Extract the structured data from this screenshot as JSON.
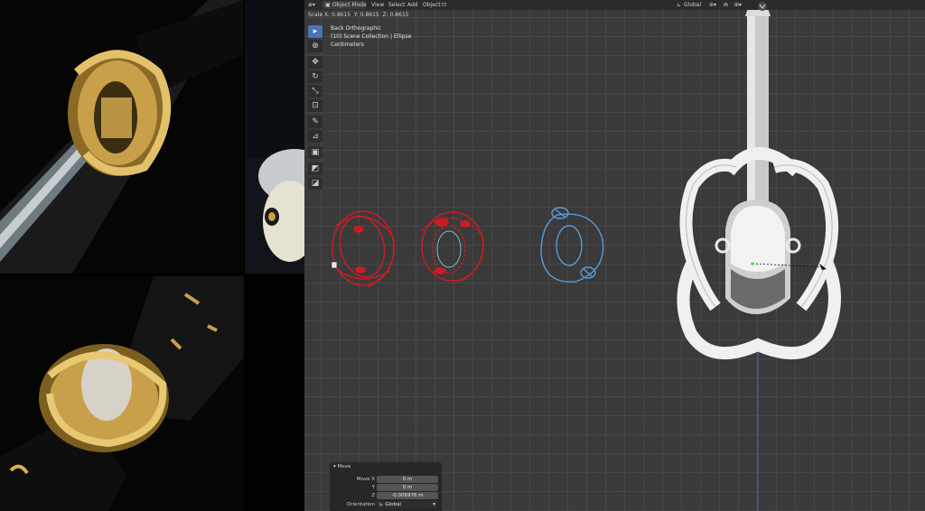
{
  "header": {
    "mode_label": "Object Mode",
    "menu": [
      "View",
      "Select",
      "Add",
      "Object"
    ],
    "transform_orientation": "Global"
  },
  "scale_readout": {
    "x": "Scale X: 0.8615",
    "y": "Y: 0.8615",
    "z": "Z: 0.8615"
  },
  "view_info": {
    "view_name": "Back Orthographic",
    "collection": "(10) Scene Collection | Ellipse",
    "units": "Centimeters"
  },
  "toolbar": {
    "tools": [
      {
        "name": "select-box-tool",
        "glyph": "▸"
      },
      {
        "name": "cursor-tool",
        "glyph": "⊕"
      },
      {
        "name": "move-tool",
        "glyph": "✥"
      },
      {
        "name": "rotate-tool",
        "glyph": "↻"
      },
      {
        "name": "scale-tool",
        "glyph": "⤡"
      },
      {
        "name": "transform-tool",
        "glyph": "⊡"
      },
      {
        "name": "annotate-tool",
        "glyph": "✎"
      },
      {
        "name": "measure-tool",
        "glyph": "⊿"
      },
      {
        "name": "add-cube-tool",
        "glyph": "▣"
      },
      {
        "name": "extrude-tool",
        "glyph": "◩"
      },
      {
        "name": "bevel-tool",
        "glyph": "◪"
      }
    ]
  },
  "move_panel": {
    "title": "Move",
    "move_x_label": "Move X",
    "move_x_value": "0 m",
    "y_label": "Y",
    "y_value": "0 m",
    "z_label": "Z",
    "z_value": "-0.006976 m",
    "orientation_label": "Orientation",
    "orientation_value": "Global"
  },
  "colors": {
    "viewport_bg": "#3a3a3a",
    "grid_line": "#474747",
    "sketch_red": "#d01a22",
    "sketch_blue": "#5a9bd6",
    "gold": "#c9a04a",
    "active_tool": "#4a73b8"
  },
  "icons": {
    "mode": "object-mode-icon",
    "orientation": "global-orientation-icon",
    "snap": "magnet-icon",
    "gizmo": "navigation-gizmo-icon"
  }
}
